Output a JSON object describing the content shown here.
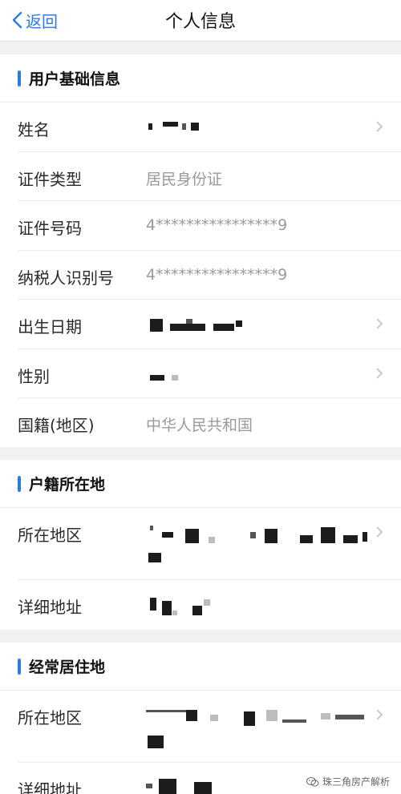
{
  "navbar": {
    "back_label": "返回",
    "title": "个人信息"
  },
  "basic": {
    "title": "用户基础信息",
    "rows": [
      {
        "label": "姓名",
        "value": ""
      },
      {
        "label": "证件类型",
        "value": "居民身份证"
      },
      {
        "label": "证件号码",
        "value": "4****************9"
      },
      {
        "label": "纳税人识别号",
        "value": "4****************9"
      },
      {
        "label": "出生日期",
        "value": ""
      },
      {
        "label": "性别",
        "value": ""
      },
      {
        "label": "国籍(地区)",
        "value": "中华人民共和国"
      }
    ]
  },
  "household": {
    "title": "户籍所在地",
    "rows": [
      {
        "label": "所在地区",
        "value": ""
      },
      {
        "label": "详细地址",
        "value": ""
      }
    ]
  },
  "residence": {
    "title": "经常居住地",
    "rows": [
      {
        "label": "所在地区",
        "value": ""
      },
      {
        "label": "详细地址",
        "value": ""
      }
    ]
  },
  "watermark": {
    "text": "珠三角房产解析"
  },
  "colors": {
    "accent": "#2b7be0",
    "background": "#f2f2f4"
  }
}
